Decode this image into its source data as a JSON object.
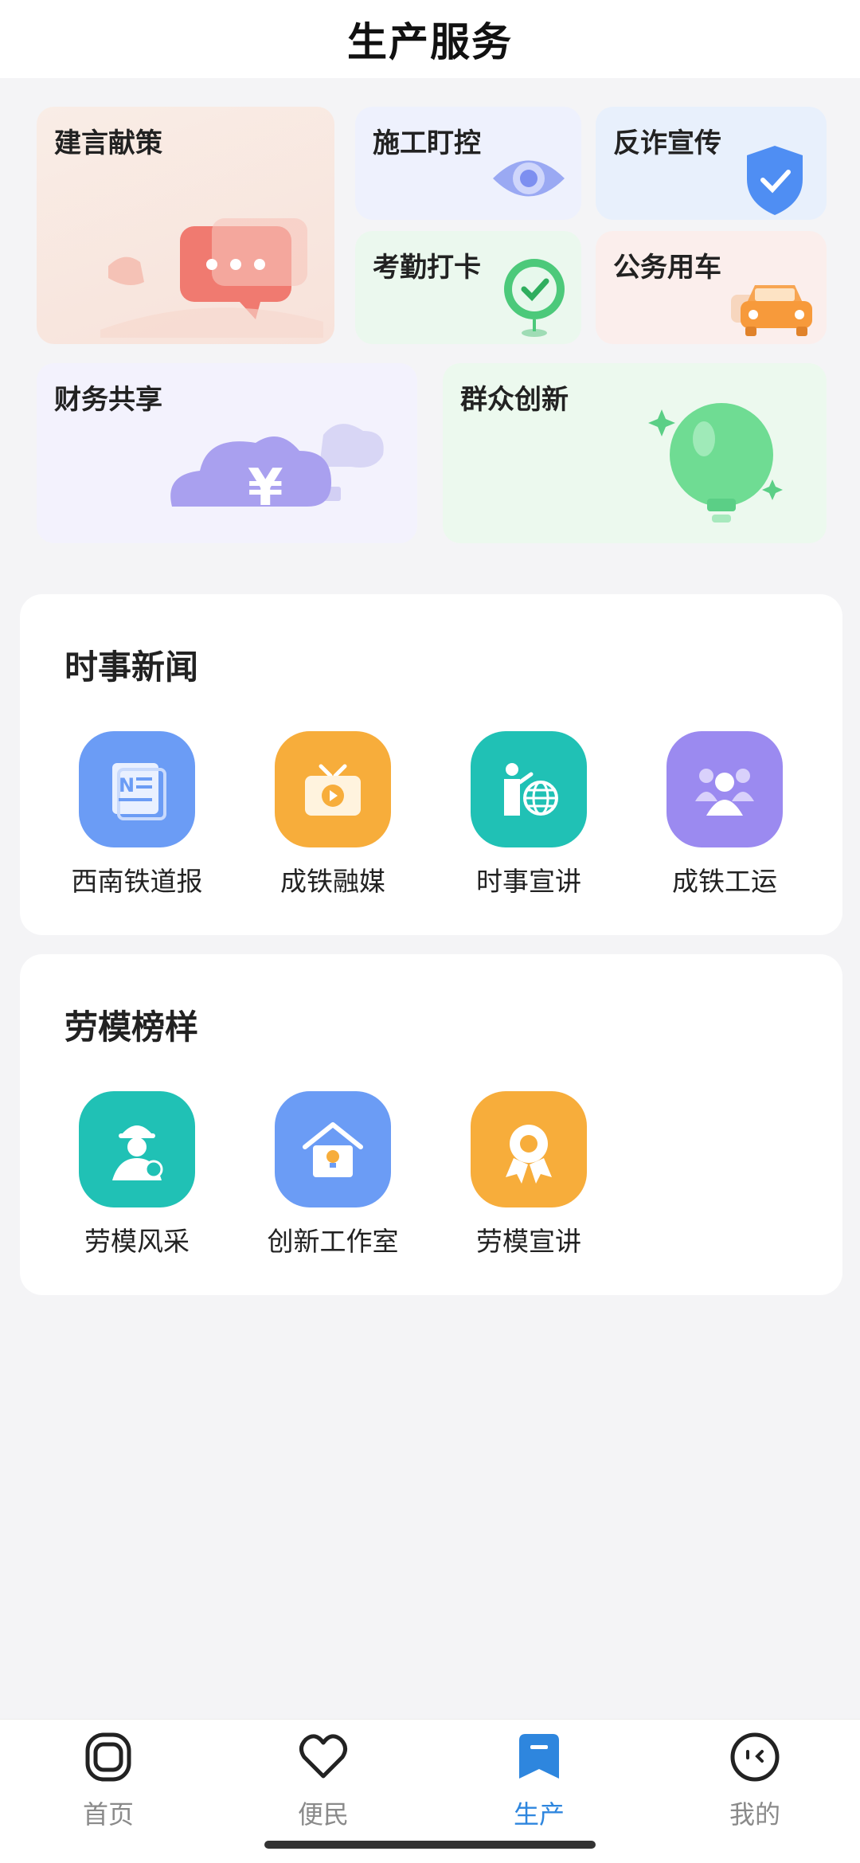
{
  "header": {
    "title": "生产服务"
  },
  "tiles": {
    "jianyan": "建言献策",
    "shigong": "施工盯控",
    "fanzha": "反诈宣传",
    "kaoqin": "考勤打卡",
    "gongwu": "公务用车",
    "caiwu": "财务共享",
    "qunzhong": "群众创新"
  },
  "news": {
    "title": "时事新闻",
    "items": [
      {
        "label": "西南铁道报",
        "icon": "newspaper-icon",
        "color": "#6b9cf5"
      },
      {
        "label": "成铁融媒",
        "icon": "tv-play-icon",
        "color": "#f7ad3b"
      },
      {
        "label": "时事宣讲",
        "icon": "presenter-globe-icon",
        "color": "#20c1b5"
      },
      {
        "label": "成铁工运",
        "icon": "group-people-icon",
        "color": "#9b8af0"
      }
    ]
  },
  "models": {
    "title": "劳模榜样",
    "items": [
      {
        "label": "劳模风采",
        "icon": "worker-icon",
        "color": "#20c1b5"
      },
      {
        "label": "创新工作室",
        "icon": "house-lightbulb-icon",
        "color": "#6b9cf5"
      },
      {
        "label": "劳模宣讲",
        "icon": "medal-icon",
        "color": "#f7ad3b"
      }
    ]
  },
  "tabbar": {
    "home": "首页",
    "convenience": "便民",
    "production": "生产",
    "mine": "我的",
    "active_color": "#2e86de"
  }
}
